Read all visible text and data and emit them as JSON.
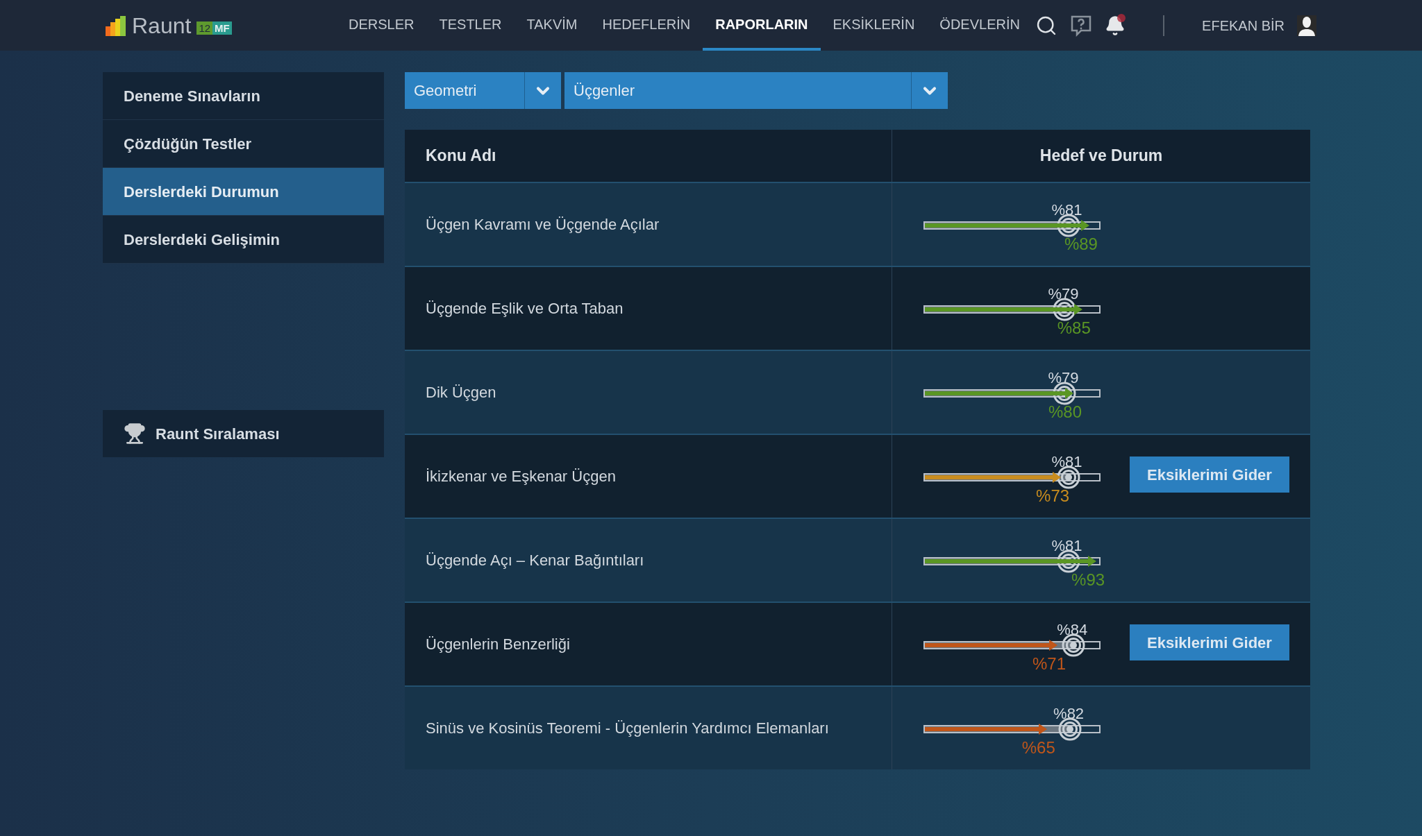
{
  "brand": {
    "name": "Raunt",
    "grade": "12",
    "track": "MF"
  },
  "nav": [
    {
      "label": "DERSLER",
      "selected": false
    },
    {
      "label": "TESTLER",
      "selected": false
    },
    {
      "label": "TAKVİM",
      "selected": false
    },
    {
      "label": "HEDEFLERİN",
      "selected": false
    },
    {
      "label": "RAPORLARIN",
      "selected": true
    },
    {
      "label": "EKSİKLERİN",
      "selected": false
    },
    {
      "label": "ÖDEVLERİN",
      "selected": false
    }
  ],
  "user": {
    "name": "EFEKAN BİR",
    "has_notification": true
  },
  "sidebar": {
    "items": [
      {
        "label": "Deneme Sınavların",
        "selected": false
      },
      {
        "label": "Çözdüğün Testler",
        "selected": false
      },
      {
        "label": "Derslerdeki Durumun",
        "selected": true
      },
      {
        "label": "Derslerdeki Gelişimin",
        "selected": false
      }
    ],
    "ranking": "Raunt Sıralaması"
  },
  "filters": {
    "subject": "Geometri",
    "topic": "Üçgenler"
  },
  "table": {
    "columns": [
      "Konu Adı",
      "Hedef ve Durum"
    ],
    "rows": [
      {
        "name": "Üçgen Kavramı ve Üçgende Açılar",
        "target": {
          "text": "%81",
          "level": 0.81
        },
        "result": {
          "text": "%89",
          "level": 0.89
        },
        "color": "#5a9624"
      },
      {
        "name": "Üçgende Eşlik ve Orta Taban",
        "target": {
          "text": "%79",
          "level": 0.79
        },
        "result": {
          "text": "%85",
          "level": 0.85
        },
        "color": "#5a9624"
      },
      {
        "name": "Dik Üçgen",
        "target": {
          "text": "%79",
          "level": 0.79
        },
        "result": {
          "text": "%80",
          "level": 0.8
        },
        "color": "#5a9624"
      },
      {
        "name": "İkizkenar ve Eşkenar Üçgen",
        "target": {
          "text": "%81",
          "level": 0.81
        },
        "result": {
          "text": "%73",
          "level": 0.73
        },
        "color": "#c88c1e",
        "action": "Eksiklerimi Gider"
      },
      {
        "name": "Üçgende Açı – Kenar Bağıntıları",
        "target": {
          "text": "%81",
          "level": 0.81
        },
        "result": {
          "text": "%93",
          "level": 0.93
        },
        "color": "#5a9624"
      },
      {
        "name": "Üçgenlerin Benzerliği",
        "target": {
          "text": "%84",
          "level": 0.84
        },
        "result": {
          "text": "%71",
          "level": 0.71
        },
        "color": "#c0561a",
        "action": "Eksiklerimi Gider"
      },
      {
        "name": "Sinüs ve Kosinüs Teoremi - Üçgenlerin Yardımcı Elemanları",
        "target": {
          "text": "%82",
          "level": 0.82
        },
        "result": {
          "text": "%65",
          "level": 0.65
        },
        "color": "#c0561a"
      }
    ]
  }
}
